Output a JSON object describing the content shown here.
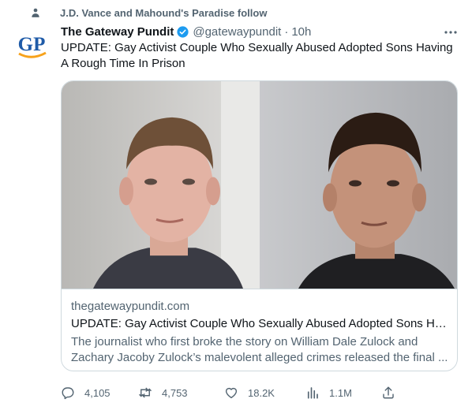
{
  "social_context": {
    "text": "J.D. Vance and Mahound's Paradise follow"
  },
  "author": {
    "avatar_text": "GP",
    "name": "The Gateway Pundit",
    "handle": "@gatewaypundit",
    "separator": "·",
    "time": "10h"
  },
  "tweet": {
    "text": "UPDATE: Gay Activist Couple Who Sexually Abused Adopted Sons Having A Rough Time In Prison"
  },
  "card": {
    "domain": "thegatewaypundit.com",
    "title": "UPDATE: Gay Activist Couple Who Sexually Abused Adopted Sons Having A Rough Time In Prison",
    "description": "The journalist who first broke the story on William Dale Zulock and Zachary Jacoby Zulock’s malevolent alleged crimes released the final ..."
  },
  "actions": {
    "replies": "4,105",
    "retweets": "4,753",
    "likes": "18.2K",
    "views": "1.1M"
  },
  "colors": {
    "text_primary": "#0f1419",
    "text_secondary": "#536471",
    "verified_blue": "#1d9bf0",
    "border": "#cfd9de",
    "logo_blue": "#1f5ba8",
    "logo_orange": "#f7a21b"
  },
  "icons": {
    "social_context": "person-icon",
    "verified": "verified-badge-icon",
    "more": "more-horizontal-icon",
    "reply": "reply-icon",
    "retweet": "retweet-icon",
    "like": "heart-icon",
    "views": "views-chart-icon",
    "share": "share-icon"
  }
}
